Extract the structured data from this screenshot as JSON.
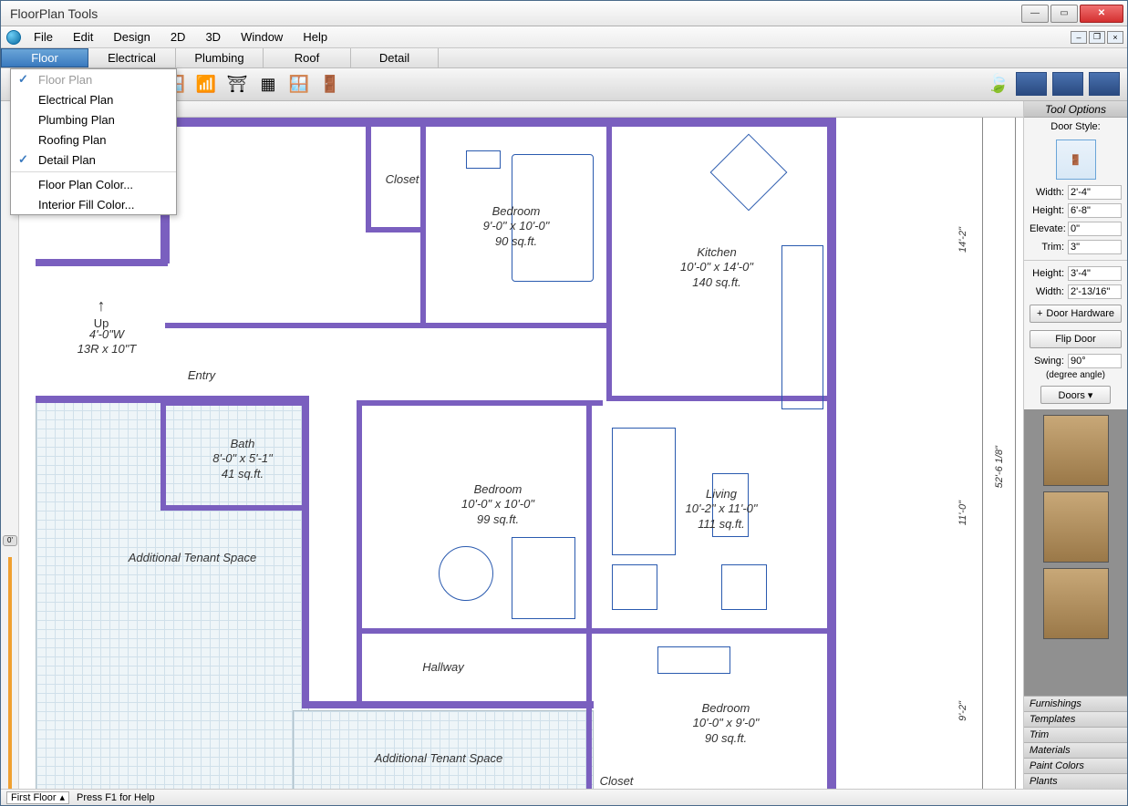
{
  "window": {
    "title": "FloorPlan Tools"
  },
  "menu": {
    "items": [
      "File",
      "Edit",
      "Design",
      "2D",
      "3D",
      "Window",
      "Help"
    ]
  },
  "tabs": {
    "items": [
      "Floor",
      "Electrical",
      "Plumbing",
      "Roof",
      "Detail"
    ],
    "active": 0
  },
  "dropdown": {
    "items": [
      {
        "label": "Floor Plan",
        "checked": true,
        "disabled": true
      },
      {
        "label": "Electrical Plan"
      },
      {
        "label": "Plumbing Plan"
      },
      {
        "label": "Roofing Plan"
      },
      {
        "label": "Detail Plan",
        "checked": true
      },
      {
        "sep": true
      },
      {
        "label": "Floor Plan Color..."
      },
      {
        "label": "Interior Fill Color..."
      }
    ]
  },
  "rooms": {
    "closet": {
      "name": "Closet"
    },
    "bedroom1": {
      "name": "Bedroom",
      "dims": "9'-0\" x 10'-0\"",
      "area": "90 sq.ft."
    },
    "kitchen": {
      "name": "Kitchen",
      "dims": "10'-0\" x 14'-0\"",
      "area": "140 sq.ft."
    },
    "entry": {
      "name": "Entry"
    },
    "bath": {
      "name": "Bath",
      "dims": "8'-0\" x 5'-1\"",
      "area": "41 sq.ft."
    },
    "bedroom2": {
      "name": "Bedroom",
      "dims": "10'-0\" x 10'-0\"",
      "area": "99 sq.ft."
    },
    "living": {
      "name": "Living",
      "dims": "10'-2\" x 11'-0\"",
      "area": "111 sq.ft."
    },
    "hallway": {
      "name": "Hallway"
    },
    "bedroom3": {
      "name": "Bedroom",
      "dims": "10'-0\" x 9'-0\"",
      "area": "90 sq.ft."
    },
    "closet2": {
      "name": "Closet"
    },
    "tenant1": {
      "name": "Additional Tenant Space"
    },
    "tenant2": {
      "name": "Additional Tenant Space"
    },
    "stairs": {
      "label": "Up",
      "dims": "4'-0\"W",
      "run": "13R x 10\"T"
    }
  },
  "outer_dims": {
    "right_top": "14'-2\"",
    "right_mid": "11'-0\"",
    "right_bot": "9'-2\"",
    "far_right": "52'-6 1/8\""
  },
  "tool_options": {
    "title": "Tool Options",
    "style_label": "Door Style:",
    "width": {
      "label": "Width:",
      "value": "2'-4\""
    },
    "height": {
      "label": "Height:",
      "value": "6'-8\""
    },
    "elevate": {
      "label": "Elevate:",
      "value": "0\""
    },
    "trim": {
      "label": "Trim:",
      "value": "3\""
    },
    "height2": {
      "label": "Height:",
      "value": "3'-4\""
    },
    "width2": {
      "label": "Width:",
      "value": "2'-13/16\""
    },
    "hardware_btn": "Door Hardware",
    "flip_btn": "Flip Door",
    "swing": {
      "label": "Swing:",
      "value": "90°",
      "note": "(degree angle)"
    },
    "doors_btn": "Doors ▾"
  },
  "catalog_tabs": [
    "Furnishings",
    "Templates",
    "Trim",
    "Materials",
    "Paint Colors",
    "Plants"
  ],
  "status": {
    "floor": "First Floor",
    "help": "Press F1 for Help"
  },
  "slider": {
    "value": "0'"
  }
}
